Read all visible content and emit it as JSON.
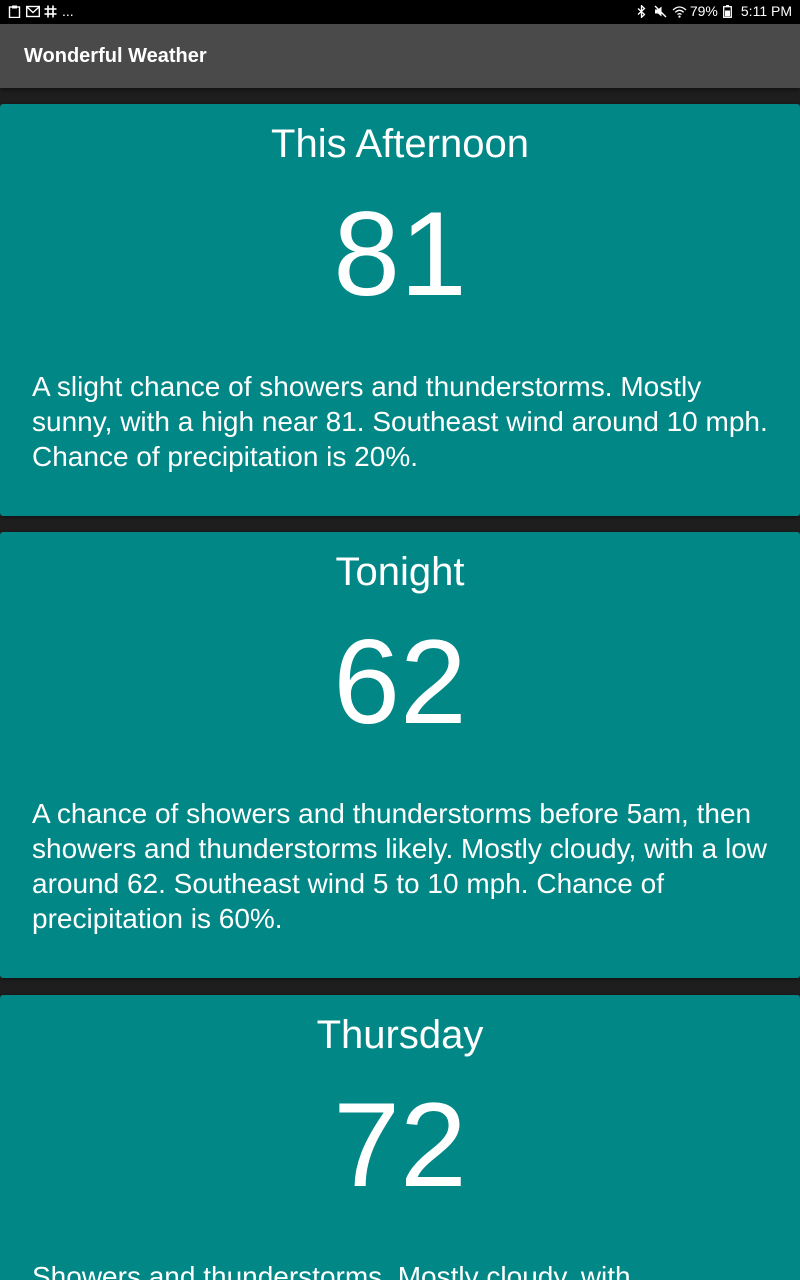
{
  "status_bar": {
    "left_icons": [
      "clipboard-icon",
      "gmail-icon",
      "slack-icon"
    ],
    "more": "...",
    "right_icons": [
      "bluetooth-icon",
      "mute-icon",
      "wifi-icon"
    ],
    "battery_percent": "79%",
    "time": "5:11 PM"
  },
  "app_bar": {
    "title": "Wonderful Weather"
  },
  "forecasts": [
    {
      "period": "This Afternoon",
      "temperature": "81",
      "description": "A slight chance of showers and thunderstorms. Mostly sunny, with a high near 81. Southeast wind around 10 mph. Chance of precipitation is 20%."
    },
    {
      "period": "Tonight",
      "temperature": "62",
      "description": "A chance of showers and thunderstorms before 5am, then showers and thunderstorms likely. Mostly cloudy, with a low around 62. Southeast wind 5 to 10 mph. Chance of precipitation is 60%."
    },
    {
      "period": "Thursday",
      "temperature": "72",
      "description": "Showers and thunderstorms. Mostly cloudy, with"
    }
  ],
  "colors": {
    "card": "#018786",
    "app_bar": "#4a4a4a",
    "background": "#1e1e1e",
    "status_bar": "#000000"
  }
}
